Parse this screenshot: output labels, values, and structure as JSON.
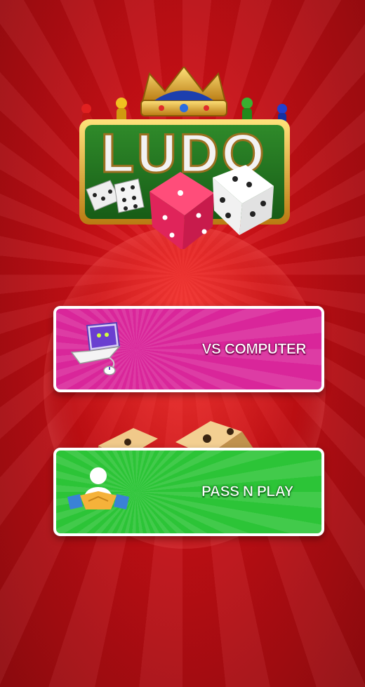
{
  "logo": {
    "text": "LUDO"
  },
  "menu": {
    "vs_computer": {
      "label": "VS COMPUTER",
      "icon": "laptop-icon"
    },
    "pass_n_play": {
      "label": "PASS N PLAY",
      "icon": "handshake-icon"
    }
  },
  "colors": {
    "background": "#c50f15",
    "vs_button": "#d9269a",
    "pass_button": "#2cc437",
    "button_border": "#ffffff"
  }
}
